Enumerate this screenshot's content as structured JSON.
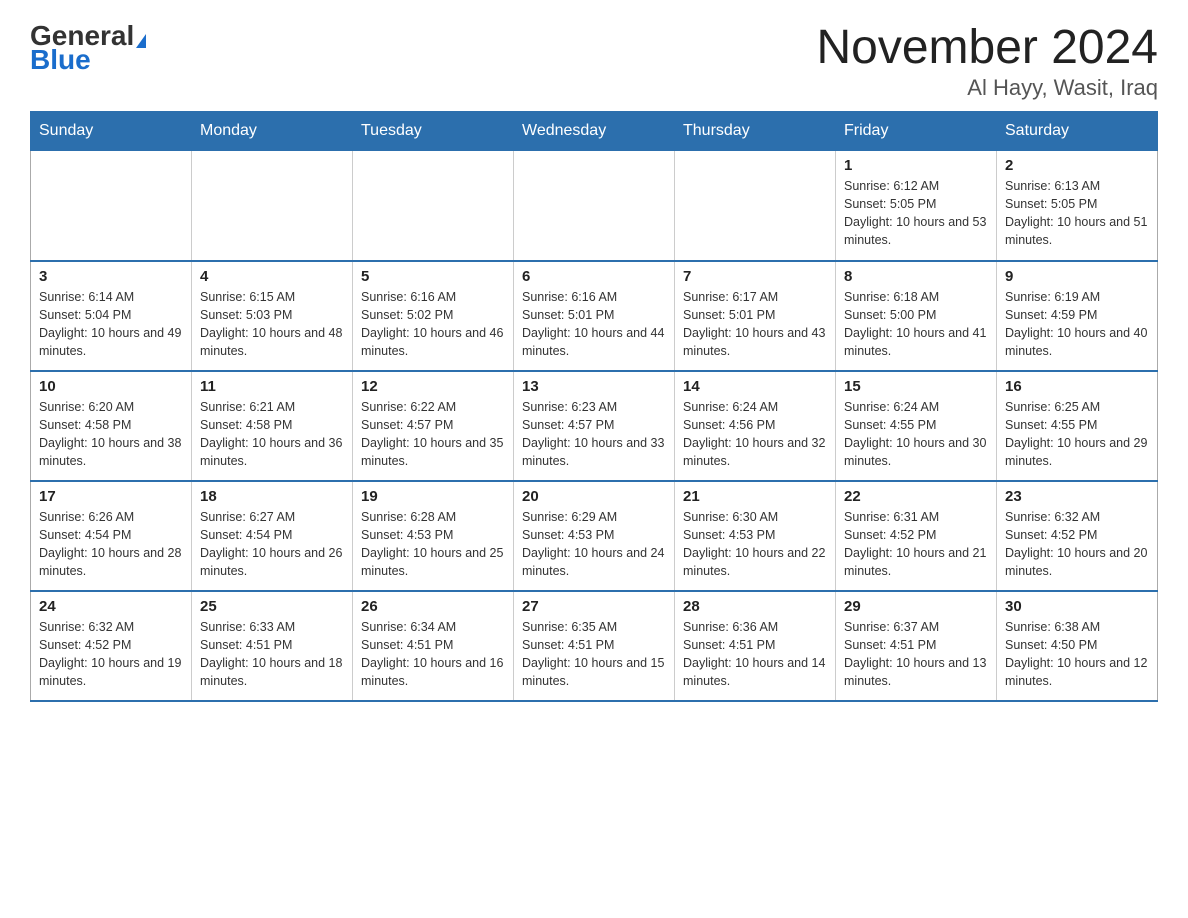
{
  "logo": {
    "general": "General",
    "blue": "Blue"
  },
  "title": {
    "month_year": "November 2024",
    "location": "Al Hayy, Wasit, Iraq"
  },
  "weekdays": [
    "Sunday",
    "Monday",
    "Tuesday",
    "Wednesday",
    "Thursday",
    "Friday",
    "Saturday"
  ],
  "weeks": [
    {
      "days": [
        {
          "number": "",
          "info": ""
        },
        {
          "number": "",
          "info": ""
        },
        {
          "number": "",
          "info": ""
        },
        {
          "number": "",
          "info": ""
        },
        {
          "number": "",
          "info": ""
        },
        {
          "number": "1",
          "info": "Sunrise: 6:12 AM\nSunset: 5:05 PM\nDaylight: 10 hours and 53 minutes."
        },
        {
          "number": "2",
          "info": "Sunrise: 6:13 AM\nSunset: 5:05 PM\nDaylight: 10 hours and 51 minutes."
        }
      ]
    },
    {
      "days": [
        {
          "number": "3",
          "info": "Sunrise: 6:14 AM\nSunset: 5:04 PM\nDaylight: 10 hours and 49 minutes."
        },
        {
          "number": "4",
          "info": "Sunrise: 6:15 AM\nSunset: 5:03 PM\nDaylight: 10 hours and 48 minutes."
        },
        {
          "number": "5",
          "info": "Sunrise: 6:16 AM\nSunset: 5:02 PM\nDaylight: 10 hours and 46 minutes."
        },
        {
          "number": "6",
          "info": "Sunrise: 6:16 AM\nSunset: 5:01 PM\nDaylight: 10 hours and 44 minutes."
        },
        {
          "number": "7",
          "info": "Sunrise: 6:17 AM\nSunset: 5:01 PM\nDaylight: 10 hours and 43 minutes."
        },
        {
          "number": "8",
          "info": "Sunrise: 6:18 AM\nSunset: 5:00 PM\nDaylight: 10 hours and 41 minutes."
        },
        {
          "number": "9",
          "info": "Sunrise: 6:19 AM\nSunset: 4:59 PM\nDaylight: 10 hours and 40 minutes."
        }
      ]
    },
    {
      "days": [
        {
          "number": "10",
          "info": "Sunrise: 6:20 AM\nSunset: 4:58 PM\nDaylight: 10 hours and 38 minutes."
        },
        {
          "number": "11",
          "info": "Sunrise: 6:21 AM\nSunset: 4:58 PM\nDaylight: 10 hours and 36 minutes."
        },
        {
          "number": "12",
          "info": "Sunrise: 6:22 AM\nSunset: 4:57 PM\nDaylight: 10 hours and 35 minutes."
        },
        {
          "number": "13",
          "info": "Sunrise: 6:23 AM\nSunset: 4:57 PM\nDaylight: 10 hours and 33 minutes."
        },
        {
          "number": "14",
          "info": "Sunrise: 6:24 AM\nSunset: 4:56 PM\nDaylight: 10 hours and 32 minutes."
        },
        {
          "number": "15",
          "info": "Sunrise: 6:24 AM\nSunset: 4:55 PM\nDaylight: 10 hours and 30 minutes."
        },
        {
          "number": "16",
          "info": "Sunrise: 6:25 AM\nSunset: 4:55 PM\nDaylight: 10 hours and 29 minutes."
        }
      ]
    },
    {
      "days": [
        {
          "number": "17",
          "info": "Sunrise: 6:26 AM\nSunset: 4:54 PM\nDaylight: 10 hours and 28 minutes."
        },
        {
          "number": "18",
          "info": "Sunrise: 6:27 AM\nSunset: 4:54 PM\nDaylight: 10 hours and 26 minutes."
        },
        {
          "number": "19",
          "info": "Sunrise: 6:28 AM\nSunset: 4:53 PM\nDaylight: 10 hours and 25 minutes."
        },
        {
          "number": "20",
          "info": "Sunrise: 6:29 AM\nSunset: 4:53 PM\nDaylight: 10 hours and 24 minutes."
        },
        {
          "number": "21",
          "info": "Sunrise: 6:30 AM\nSunset: 4:53 PM\nDaylight: 10 hours and 22 minutes."
        },
        {
          "number": "22",
          "info": "Sunrise: 6:31 AM\nSunset: 4:52 PM\nDaylight: 10 hours and 21 minutes."
        },
        {
          "number": "23",
          "info": "Sunrise: 6:32 AM\nSunset: 4:52 PM\nDaylight: 10 hours and 20 minutes."
        }
      ]
    },
    {
      "days": [
        {
          "number": "24",
          "info": "Sunrise: 6:32 AM\nSunset: 4:52 PM\nDaylight: 10 hours and 19 minutes."
        },
        {
          "number": "25",
          "info": "Sunrise: 6:33 AM\nSunset: 4:51 PM\nDaylight: 10 hours and 18 minutes."
        },
        {
          "number": "26",
          "info": "Sunrise: 6:34 AM\nSunset: 4:51 PM\nDaylight: 10 hours and 16 minutes."
        },
        {
          "number": "27",
          "info": "Sunrise: 6:35 AM\nSunset: 4:51 PM\nDaylight: 10 hours and 15 minutes."
        },
        {
          "number": "28",
          "info": "Sunrise: 6:36 AM\nSunset: 4:51 PM\nDaylight: 10 hours and 14 minutes."
        },
        {
          "number": "29",
          "info": "Sunrise: 6:37 AM\nSunset: 4:51 PM\nDaylight: 10 hours and 13 minutes."
        },
        {
          "number": "30",
          "info": "Sunrise: 6:38 AM\nSunset: 4:50 PM\nDaylight: 10 hours and 12 minutes."
        }
      ]
    }
  ]
}
